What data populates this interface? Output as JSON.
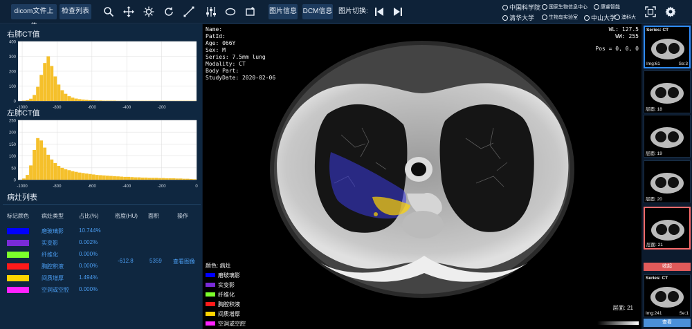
{
  "toolbar": {
    "upload_label": "dicom文件上传",
    "check_list_label": "检查列表",
    "image_info_label": "图片信息",
    "dcm_info_label": "DCM信息",
    "image_switch_label": "图片切换:",
    "tools": [
      "search-icon",
      "move-icon",
      "brightness-icon",
      "rotate-icon",
      "measure-line-icon",
      "adjust-sliders-icon",
      "ellipse-icon",
      "rectangle-icon"
    ],
    "logos": [
      "中国科学院",
      "国家生物信息中心",
      "康睿智能",
      "清华大学",
      "生物岛实验室",
      "中山大学",
      "澳科大"
    ]
  },
  "charts": [
    {
      "title": "右肺CT值",
      "ytick_labels": [
        "400",
        "300",
        "200",
        "100",
        "0"
      ],
      "xtick_labels": [
        "-1000",
        "-800",
        "-600",
        "-400",
        "-200"
      ]
    },
    {
      "title": "左肺CT值",
      "ytick_labels": [
        "250",
        "200",
        "150",
        "100",
        "50",
        "0"
      ],
      "xtick_labels": [
        "-1000",
        "-800",
        "-600",
        "-400",
        "-200",
        "0"
      ]
    }
  ],
  "chart_data": [
    {
      "type": "bar",
      "title": "右肺CT值",
      "xlim": [
        -1024,
        0
      ],
      "ylim": [
        0,
        400
      ],
      "x": [
        -1000,
        -980,
        -960,
        -940,
        -920,
        -900,
        -880,
        -860,
        -840,
        -820,
        -800,
        -780,
        -760,
        -740,
        -720,
        -700,
        -680,
        -660,
        -640,
        -620,
        -600,
        -580,
        -560,
        -540,
        -520,
        -500,
        -480,
        -460,
        -440,
        -420,
        -400,
        -380,
        -360,
        -340,
        -320,
        -300,
        -280,
        -260,
        -240,
        -220,
        -200,
        -180,
        -160,
        -140,
        -120,
        -100,
        -80,
        -60,
        -40,
        -20
      ],
      "values": [
        2,
        5,
        15,
        40,
        95,
        175,
        255,
        300,
        235,
        165,
        110,
        72,
        48,
        32,
        22,
        16,
        12,
        9,
        7,
        5,
        4,
        3,
        3,
        2,
        2,
        2,
        2,
        1,
        1,
        1,
        1,
        1,
        1,
        1,
        1,
        1,
        1,
        1,
        1,
        1,
        1,
        1,
        1,
        1,
        1,
        1,
        1,
        1,
        1,
        1
      ],
      "color": "#f5c02b"
    },
    {
      "type": "bar",
      "title": "左肺CT值",
      "xlim": [
        -1024,
        0
      ],
      "ylim": [
        0,
        250
      ],
      "x": [
        -1000,
        -980,
        -960,
        -940,
        -920,
        -900,
        -880,
        -860,
        -840,
        -820,
        -800,
        -780,
        -760,
        -740,
        -720,
        -700,
        -680,
        -660,
        -640,
        -620,
        -600,
        -580,
        -560,
        -540,
        -520,
        -500,
        -480,
        -460,
        -440,
        -420,
        -400,
        -380,
        -360,
        -340,
        -320,
        -300,
        -280,
        -260,
        -240,
        -220,
        -200,
        -180,
        -160,
        -140,
        -120,
        -100,
        -80,
        -60,
        -40,
        -20
      ],
      "values": [
        5,
        20,
        60,
        125,
        175,
        165,
        135,
        105,
        85,
        70,
        58,
        50,
        44,
        40,
        36,
        33,
        30,
        28,
        26,
        24,
        22,
        20,
        19,
        18,
        17,
        16,
        15,
        14,
        13,
        12,
        12,
        11,
        10,
        10,
        9,
        9,
        8,
        8,
        8,
        7,
        7,
        6,
        6,
        6,
        5,
        5,
        4,
        4,
        3,
        2
      ],
      "color": "#f5c02b"
    }
  ],
  "lesion_table": {
    "title": "病灶列表",
    "headers": [
      "标记颜色",
      "病灶类型",
      "占比(%)",
      "密度(HU)",
      "面积",
      "操作"
    ],
    "rows": [
      {
        "color": "#0000ff",
        "name": "磨玻璃影",
        "pct": "10.744%"
      },
      {
        "color": "#7a2bd8",
        "name": "实变影",
        "pct": "0.002%"
      },
      {
        "color": "#7cff2b",
        "name": "纤维化",
        "pct": "0.000%"
      },
      {
        "color": "#ff1a1a",
        "name": "胸腔积液",
        "pct": "0.000%"
      },
      {
        "color": "#ffd400",
        "name": "间质增厚",
        "pct": "1.494%"
      },
      {
        "color": "#ff22ff",
        "name": "空洞或空腔",
        "pct": "0.000%"
      }
    ],
    "density": "-612.8",
    "area": "5359",
    "action": "查看图像"
  },
  "viewer": {
    "info": [
      "Name:",
      "PatId:",
      "Age: 066Y",
      "Sex: M",
      "Series: 7.5mm lung",
      "Modality: CT",
      "Body Part:",
      "StudyDate: 2020-02-06"
    ],
    "wl": "WL: 127.5",
    "ww": "WW: 255",
    "pos": "Pos = 0, 0, 0",
    "legend_title": "颜色: 病灶",
    "legend": [
      {
        "color": "#0000ff",
        "label": "磨玻璃影"
      },
      {
        "color": "#7a2bd8",
        "label": "实变影"
      },
      {
        "color": "#7cff2b",
        "label": "纤维化"
      },
      {
        "color": "#ff1a1a",
        "label": "胸腔积液"
      },
      {
        "color": "#ffd400",
        "label": "间质增厚"
      },
      {
        "color": "#ff22ff",
        "label": "空洞或空腔"
      }
    ],
    "slice": "层面: 21"
  },
  "thumbnails": {
    "series_top": "Series: CT",
    "img_top": "Img:61",
    "se_top": "Se:3",
    "slices": [
      "层面: 18",
      "层面: 19",
      "层面: 20",
      "层面: 21"
    ],
    "collapse_label": "收起",
    "series_bottom": "Series: CT",
    "img_bottom": "Img:241",
    "se_bottom": "Se:1",
    "view_label": "查看"
  }
}
